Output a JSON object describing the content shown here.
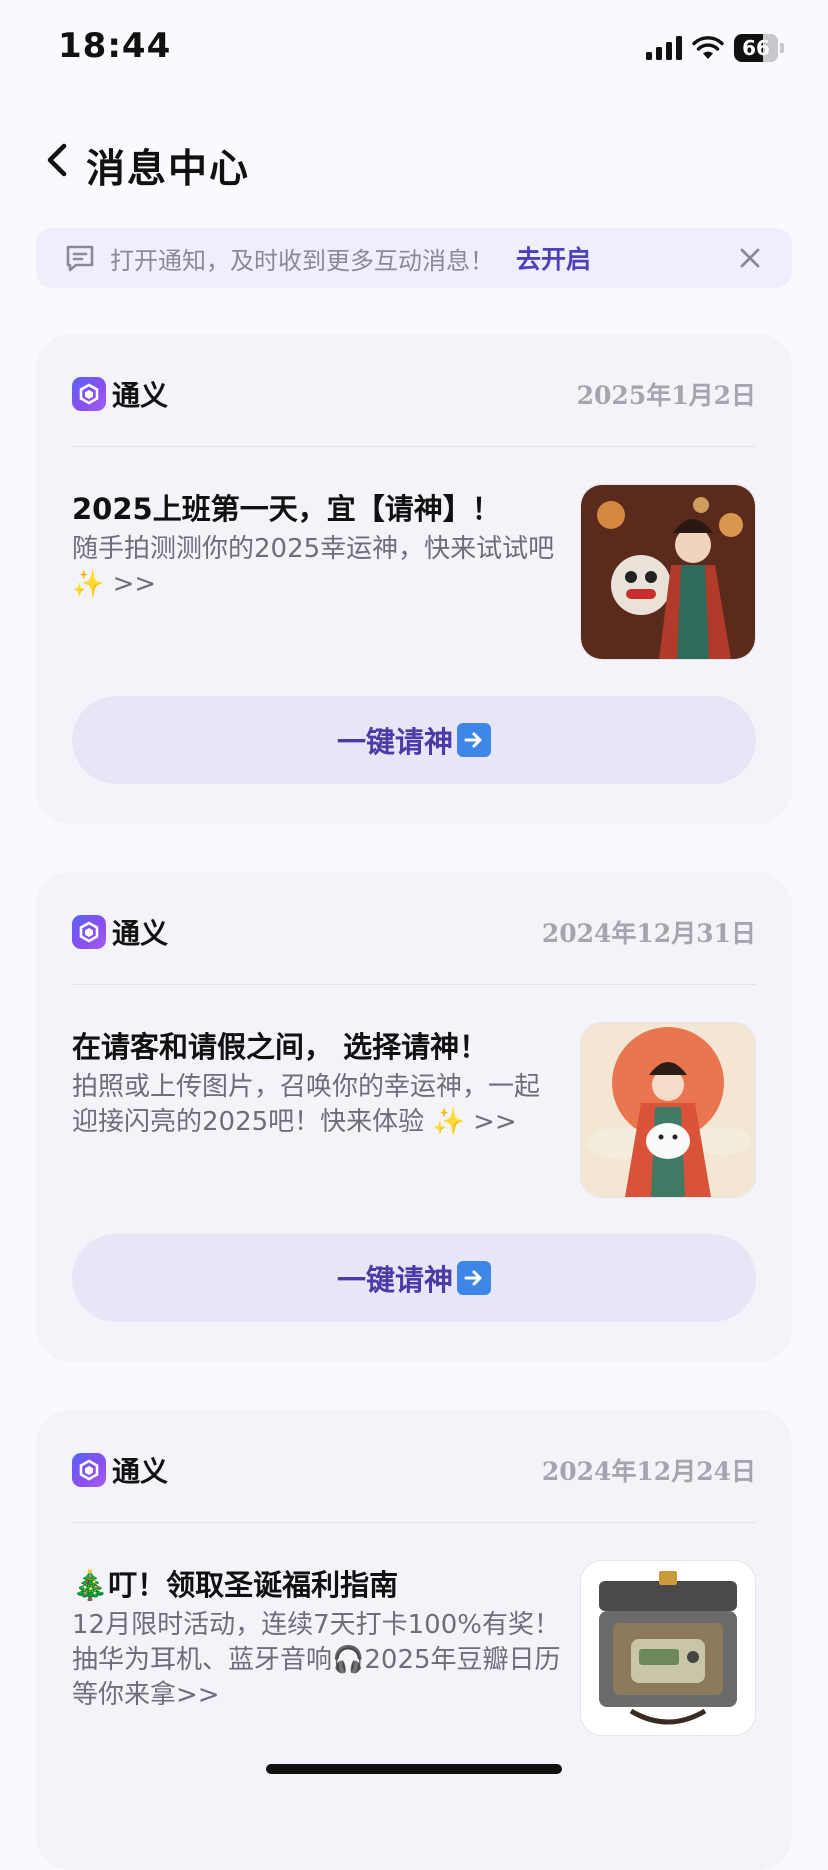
{
  "status_bar": {
    "time": "18:44",
    "battery": "66"
  },
  "header": {
    "title": "消息中心"
  },
  "banner": {
    "text": "打开通知，及时收到更多互动消息！",
    "link": "去开启"
  },
  "messages": [
    {
      "app": "通义",
      "date": "2025年1月2日",
      "title": "2025上班第一天，宜【请神】！",
      "body": "随手拍测测你的2025幸运神，快来试试吧",
      "body_suffix": ">>",
      "button": "一键请神"
    },
    {
      "app": "通义",
      "date": "2024年12月31日",
      "title": "在请客和请假之间， 选择请神！",
      "body": "拍照或上传图片，召唤你的幸运神，一起迎接闪亮的2025吧！快来体验",
      "body_suffix": ">>",
      "button": "一键请神"
    },
    {
      "app": "通义",
      "date": "2024年12月24日",
      "title": "叮！领取圣诞福利指南",
      "body_part1": "12月限时活动，连续7天打卡100%有奖！抽华为耳机、蓝牙音响",
      "body_part2": "2025年豆瓣日历等你来拿>>"
    }
  ],
  "colors": {
    "accent": "#4f3fb8",
    "card_bg": "#f3f3f9",
    "button_bg": "#e7e6f6"
  },
  "icons": [
    "back-arrow-icon",
    "message-icon",
    "close-icon",
    "tongyi-logo-icon",
    "right-arrow-emoji-icon",
    "sparkles-icon",
    "christmas-tree-icon",
    "headphones-icon"
  ]
}
